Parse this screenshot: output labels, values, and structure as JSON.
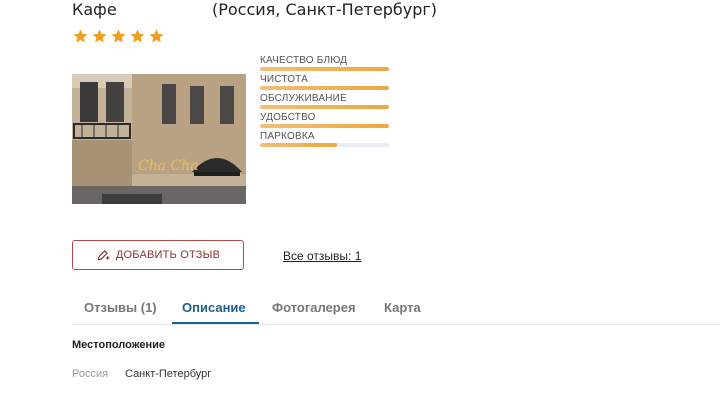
{
  "header": {
    "title": "Кафе",
    "location": "(Россия, Санкт-Петербург)"
  },
  "rating": {
    "stars": 5,
    "max": 5,
    "star_color": "#f0a020"
  },
  "ratings": [
    {
      "label": "КАЧЕСТВО БЛЮД",
      "value": 1.0
    },
    {
      "label": "ЧИСТОТА",
      "value": 1.0
    },
    {
      "label": "ОБСЛУЖИВАНИЕ",
      "value": 1.0
    },
    {
      "label": "УДОБСТВО",
      "value": 1.0
    },
    {
      "label": "ПАРКОВКА",
      "value": 0.6
    }
  ],
  "photo": {
    "sign_text": "Cha Cha"
  },
  "actions": {
    "add_review": "ДОБАВИТЬ ОТЗЫВ",
    "all_reviews": "Все отзывы: 1",
    "add_review_color": "#b34a4a"
  },
  "tabs": [
    {
      "label": "Отзывы (1)"
    },
    {
      "label": "Описание",
      "active": true
    },
    {
      "label": "Фотогалерея"
    },
    {
      "label": "Карта"
    }
  ],
  "location_section": {
    "title": "Местоположение",
    "country": "Россия",
    "city": "Санкт-Петербург"
  }
}
